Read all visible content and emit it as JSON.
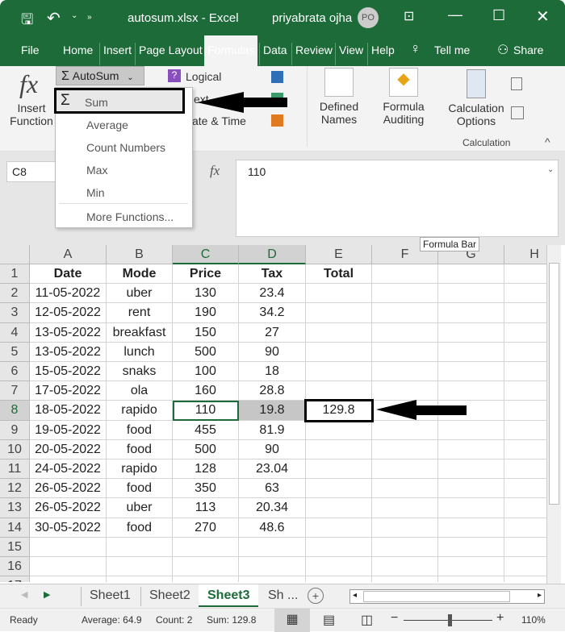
{
  "window": {
    "file_title": "autosum.xlsx  -  Excel",
    "user": "priyabrata ojha",
    "avatar_initials": "PO"
  },
  "tabs": [
    "File",
    "Home",
    "Insert",
    "Page Layout",
    "Formulas",
    "Data",
    "Review",
    "View",
    "Help",
    "Tell me",
    "Share"
  ],
  "active_tab": "Formulas",
  "ribbon": {
    "insert_function": [
      "Insert",
      "Function"
    ],
    "autosum": "AutoSum",
    "logical": "Logical",
    "text": "ext",
    "date_time": "ate & Time",
    "defined_names": [
      "Defined",
      "Names"
    ],
    "formula_auditing": [
      "Formula",
      "Auditing"
    ],
    "calculation_options": [
      "Calculation",
      "Options"
    ],
    "calculation_group": "Calculation"
  },
  "autosum_menu": [
    "Sum",
    "Average",
    "Count Numbers",
    "Max",
    "Min",
    "More Functions..."
  ],
  "name_box": "C8",
  "fx": "fx",
  "formula_value": "110",
  "tooltip": "Formula Bar",
  "columns": [
    "A",
    "B",
    "C",
    "D",
    "E",
    "F",
    "G",
    "H"
  ],
  "rows": [
    [
      "Date",
      "Mode",
      "Price",
      "Tax",
      "Total"
    ],
    [
      "11-05-2022",
      "uber",
      "130",
      "23.4",
      ""
    ],
    [
      "12-05-2022",
      "rent",
      "190",
      "34.2",
      ""
    ],
    [
      "13-05-2022",
      "breakfast",
      "150",
      "27",
      ""
    ],
    [
      "13-05-2022",
      "lunch",
      "500",
      "90",
      ""
    ],
    [
      "15-05-2022",
      "snaks",
      "100",
      "18",
      ""
    ],
    [
      "17-05-2022",
      "ola",
      "160",
      "28.8",
      ""
    ],
    [
      "18-05-2022",
      "rapido",
      "110",
      "19.8",
      "129.8"
    ],
    [
      "19-05-2022",
      "food",
      "455",
      "81.9",
      ""
    ],
    [
      "20-05-2022",
      "food",
      "500",
      "90",
      ""
    ],
    [
      "24-05-2022",
      "rapido",
      "128",
      "23.04",
      ""
    ],
    [
      "26-05-2022",
      "food",
      "350",
      "63",
      ""
    ],
    [
      "26-05-2022",
      "uber",
      "113",
      "20.34",
      ""
    ],
    [
      "30-05-2022",
      "food",
      "270",
      "48.6",
      ""
    ],
    [],
    [],
    []
  ],
  "sheets": [
    "Sheet1",
    "Sheet2",
    "Sheet3",
    "Sh ..."
  ],
  "active_sheet": "Sheet3",
  "status": {
    "ready": "Ready",
    "average": "Average: 64.9",
    "count": "Count: 2",
    "sum": "Sum: 129.8",
    "zoom": "110%"
  },
  "colors": {
    "excel_green": "#1e6b3a",
    "selection": "#c6c6c6"
  }
}
